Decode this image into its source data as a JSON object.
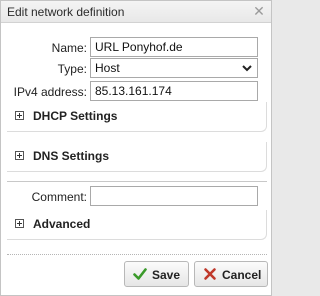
{
  "dialog": {
    "title": "Edit network definition"
  },
  "form": {
    "name_label": "Name:",
    "name_value": "URL Ponyhof.de",
    "type_label": "Type:",
    "type_value": "Host",
    "ipv4_label": "IPv4 address:",
    "ipv4_value": "85.13.161.174",
    "comment_label": "Comment:",
    "comment_value": ""
  },
  "sections": {
    "dhcp": "DHCP Settings",
    "dns": "DNS Settings",
    "advanced": "Advanced"
  },
  "buttons": {
    "save": "Save",
    "cancel": "Cancel"
  },
  "icons": {
    "close": "close-icon",
    "save": "checkmark-icon",
    "cancel": "x-icon",
    "expand": "plus-box-icon",
    "dropdown": "chevron-down-icon"
  },
  "colors": {
    "save_check": "#3a9a2a",
    "cancel_x": "#c0392b"
  }
}
